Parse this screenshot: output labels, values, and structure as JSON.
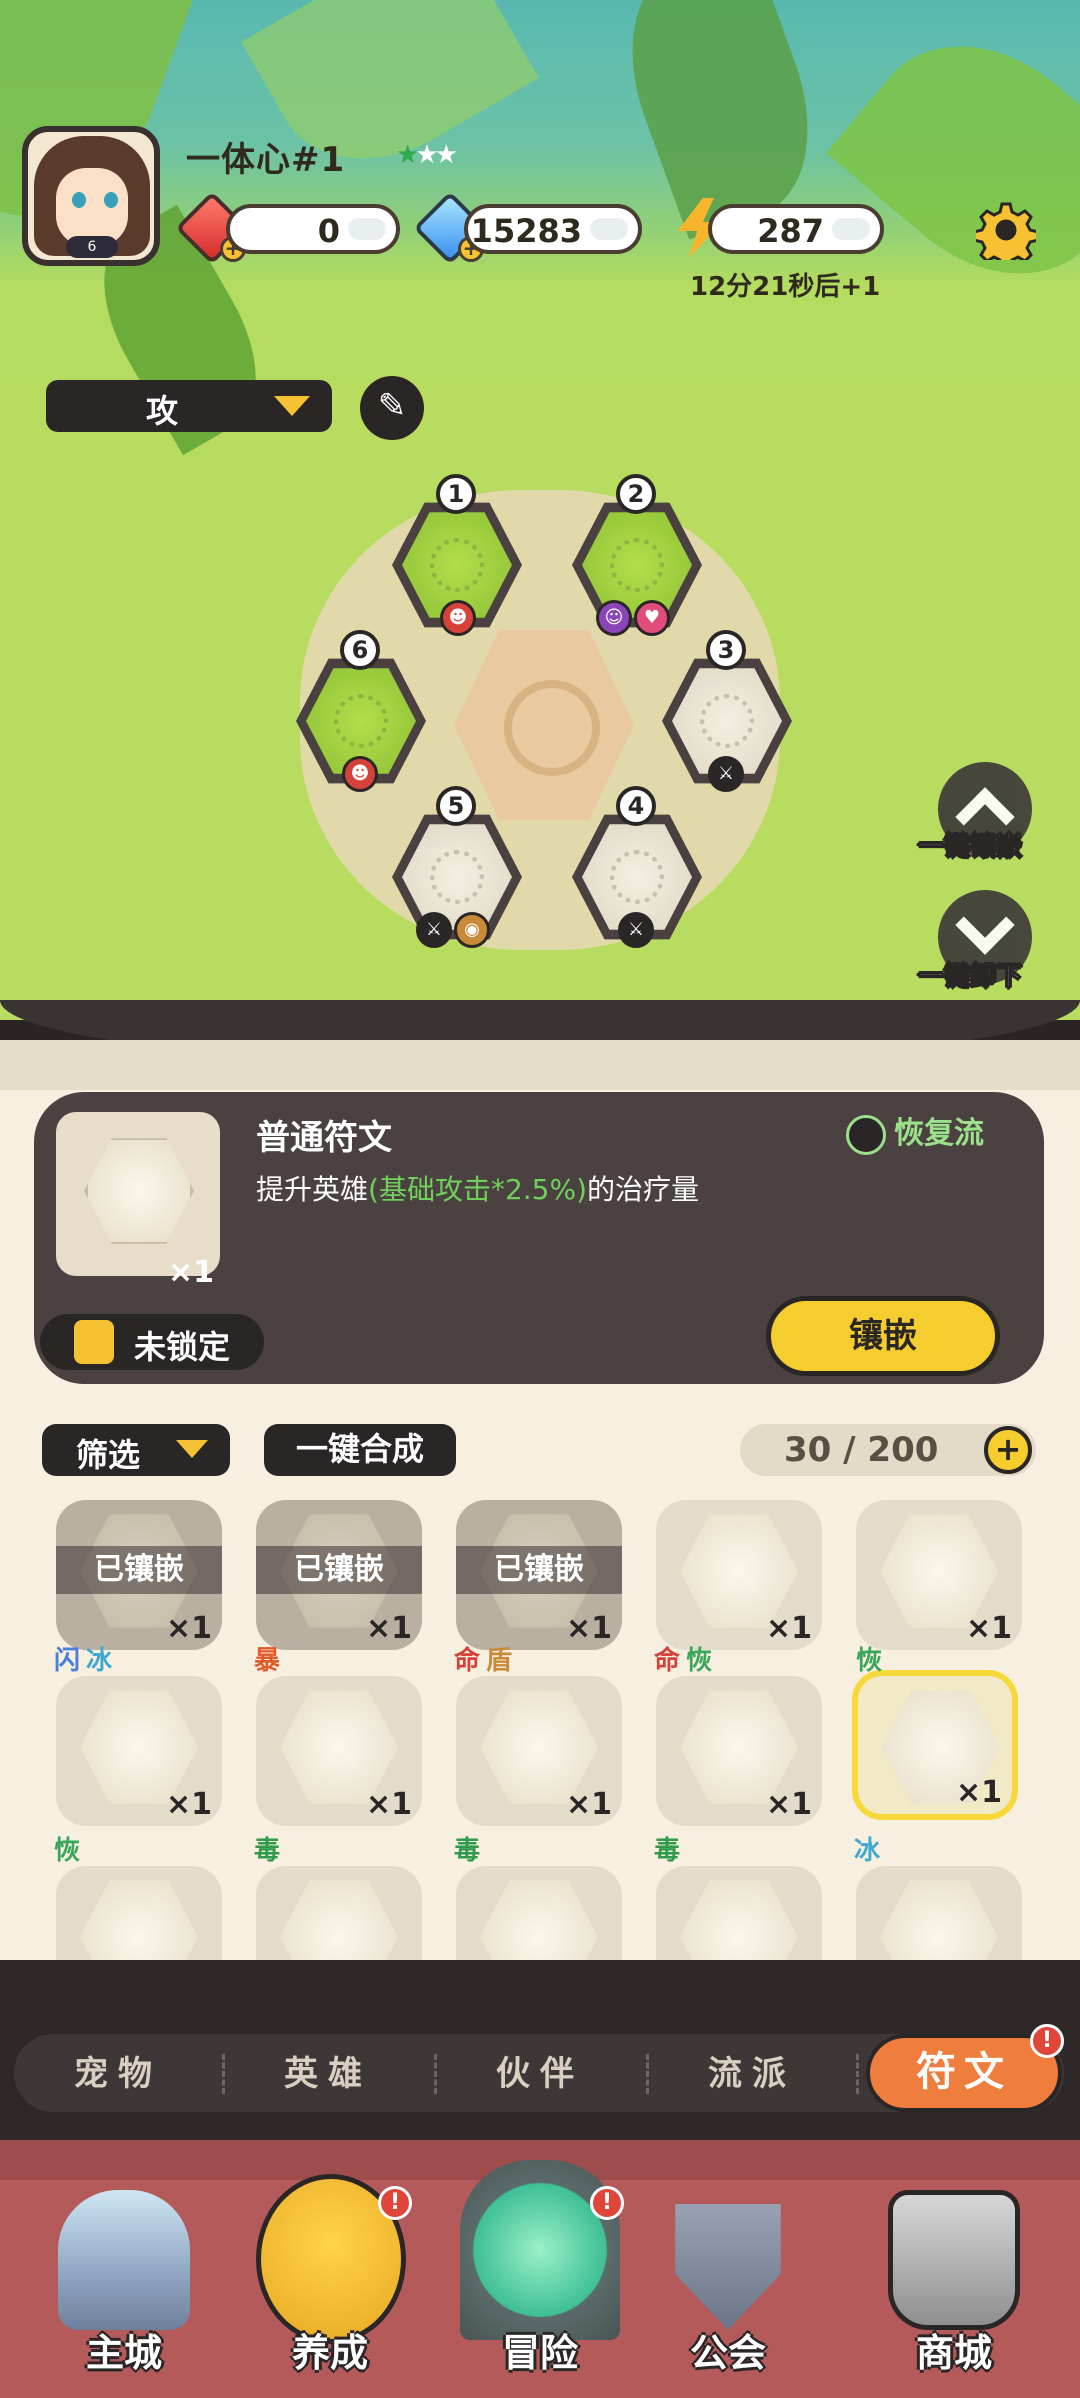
{
  "player": {
    "name": "一体心#1",
    "avatar_level": "6",
    "stars_filled": 1,
    "stars_total": 3
  },
  "resources": {
    "red_gem": "0",
    "blue_gem": "15283",
    "energy": "287",
    "energy_timer": "12分21秒后+1"
  },
  "mode": {
    "selected": "攻"
  },
  "rune_slots": [
    {
      "num": "1",
      "filled": true
    },
    {
      "num": "2",
      "filled": true
    },
    {
      "num": "3",
      "filled": false
    },
    {
      "num": "4",
      "filled": false
    },
    {
      "num": "5",
      "filled": false
    },
    {
      "num": "6",
      "filled": true
    }
  ],
  "side_buttons": {
    "inlay_all": "一键镶嵌",
    "remove_all": "一键卸下"
  },
  "detail": {
    "title": "普通符文",
    "desc_prefix": "提升英雄",
    "desc_highlight": "(基础攻击*2.5%)",
    "desc_suffix": "的治疗量",
    "count": "×1",
    "school": "恢复流",
    "lock_status": "未锁定",
    "inlay_button": "镶嵌"
  },
  "toolbar": {
    "filter": "筛选",
    "merge": "一键合成",
    "capacity": "30 / 200"
  },
  "inventory": {
    "inlaid_label": "已镶嵌",
    "row1": [
      {
        "count": "×1",
        "inlaid": true
      },
      {
        "count": "×1",
        "inlaid": true
      },
      {
        "count": "×1",
        "inlaid": true
      },
      {
        "count": "×1",
        "inlaid": false
      },
      {
        "count": "×1",
        "inlaid": false
      }
    ],
    "row2": [
      {
        "count": "×1",
        "tags": [
          {
            "t": "闪",
            "c": "#4a7fd8"
          },
          {
            "t": "冰",
            "c": "#3fa8d0"
          }
        ]
      },
      {
        "count": "×1",
        "tags": [
          {
            "t": "暴",
            "c": "#e05a2a"
          }
        ]
      },
      {
        "count": "×1",
        "tags": [
          {
            "t": "命",
            "c": "#d6423a"
          },
          {
            "t": "盾",
            "c": "#c98a3a"
          }
        ]
      },
      {
        "count": "×1",
        "tags": [
          {
            "t": "命",
            "c": "#d6423a"
          },
          {
            "t": "恢",
            "c": "#3aa65a"
          }
        ]
      },
      {
        "count": "×1",
        "tags": [
          {
            "t": "恢",
            "c": "#3aa65a"
          }
        ],
        "selected": true
      }
    ],
    "row3": [
      {
        "tags": [
          {
            "t": "恢",
            "c": "#3aa65a"
          }
        ]
      },
      {
        "tags": [
          {
            "t": "毒",
            "c": "#2f9a4a"
          }
        ]
      },
      {
        "tags": [
          {
            "t": "毒",
            "c": "#2f9a4a"
          }
        ]
      },
      {
        "tags": [
          {
            "t": "毒",
            "c": "#2f9a4a"
          }
        ]
      },
      {
        "tags": [
          {
            "t": "冰",
            "c": "#3fa8d0"
          }
        ]
      }
    ]
  },
  "subtabs": [
    "宠物",
    "英雄",
    "伙伴",
    "流派",
    "符文"
  ],
  "subtab_badge": "!",
  "nav": {
    "items": [
      "主城",
      "养成",
      "冒险",
      "公会",
      "商城"
    ],
    "badge": "!"
  },
  "colors": {
    "accent_yellow": "#f6cd2e",
    "active_tab": "#ef7d3d",
    "highlight_green": "#6fd15a"
  }
}
